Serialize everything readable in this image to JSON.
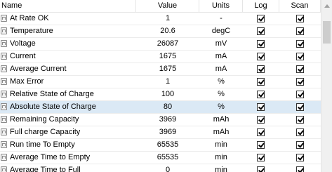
{
  "columns": {
    "name": "Name",
    "value": "Value",
    "units": "Units",
    "log": "Log",
    "scan": "Scan"
  },
  "rows": [
    {
      "name": "At Rate OK",
      "value": "1",
      "units": "-",
      "log": true,
      "scan": true,
      "selected": false
    },
    {
      "name": "Temperature",
      "value": "20.6",
      "units": "degC",
      "log": true,
      "scan": true,
      "selected": false
    },
    {
      "name": "Voltage",
      "value": "26087",
      "units": "mV",
      "log": true,
      "scan": true,
      "selected": false
    },
    {
      "name": "Current",
      "value": "1675",
      "units": "mA",
      "log": true,
      "scan": true,
      "selected": false
    },
    {
      "name": "Average Current",
      "value": "1675",
      "units": "mA",
      "log": true,
      "scan": true,
      "selected": false
    },
    {
      "name": "Max Error",
      "value": "1",
      "units": "%",
      "log": true,
      "scan": true,
      "selected": false
    },
    {
      "name": "Relative State of Charge",
      "value": "100",
      "units": "%",
      "log": true,
      "scan": true,
      "selected": false
    },
    {
      "name": "Absolute State of Charge",
      "value": "80",
      "units": "%",
      "log": true,
      "scan": true,
      "selected": true
    },
    {
      "name": "Remaining Capacity",
      "value": "3969",
      "units": "mAh",
      "log": true,
      "scan": true,
      "selected": false
    },
    {
      "name": "Full charge Capacity",
      "value": "3969",
      "units": "mAh",
      "log": true,
      "scan": true,
      "selected": false
    },
    {
      "name": "Run time To Empty",
      "value": "65535",
      "units": "min",
      "log": true,
      "scan": true,
      "selected": false
    },
    {
      "name": "Average Time to Empty",
      "value": "65535",
      "units": "min",
      "log": true,
      "scan": true,
      "selected": false
    },
    {
      "name": "Average Time to Full",
      "value": "0",
      "units": "min",
      "log": true,
      "scan": true,
      "selected": false
    }
  ],
  "icons": {
    "row": "lock-icon",
    "scroll_up": "arrow-up-icon"
  }
}
